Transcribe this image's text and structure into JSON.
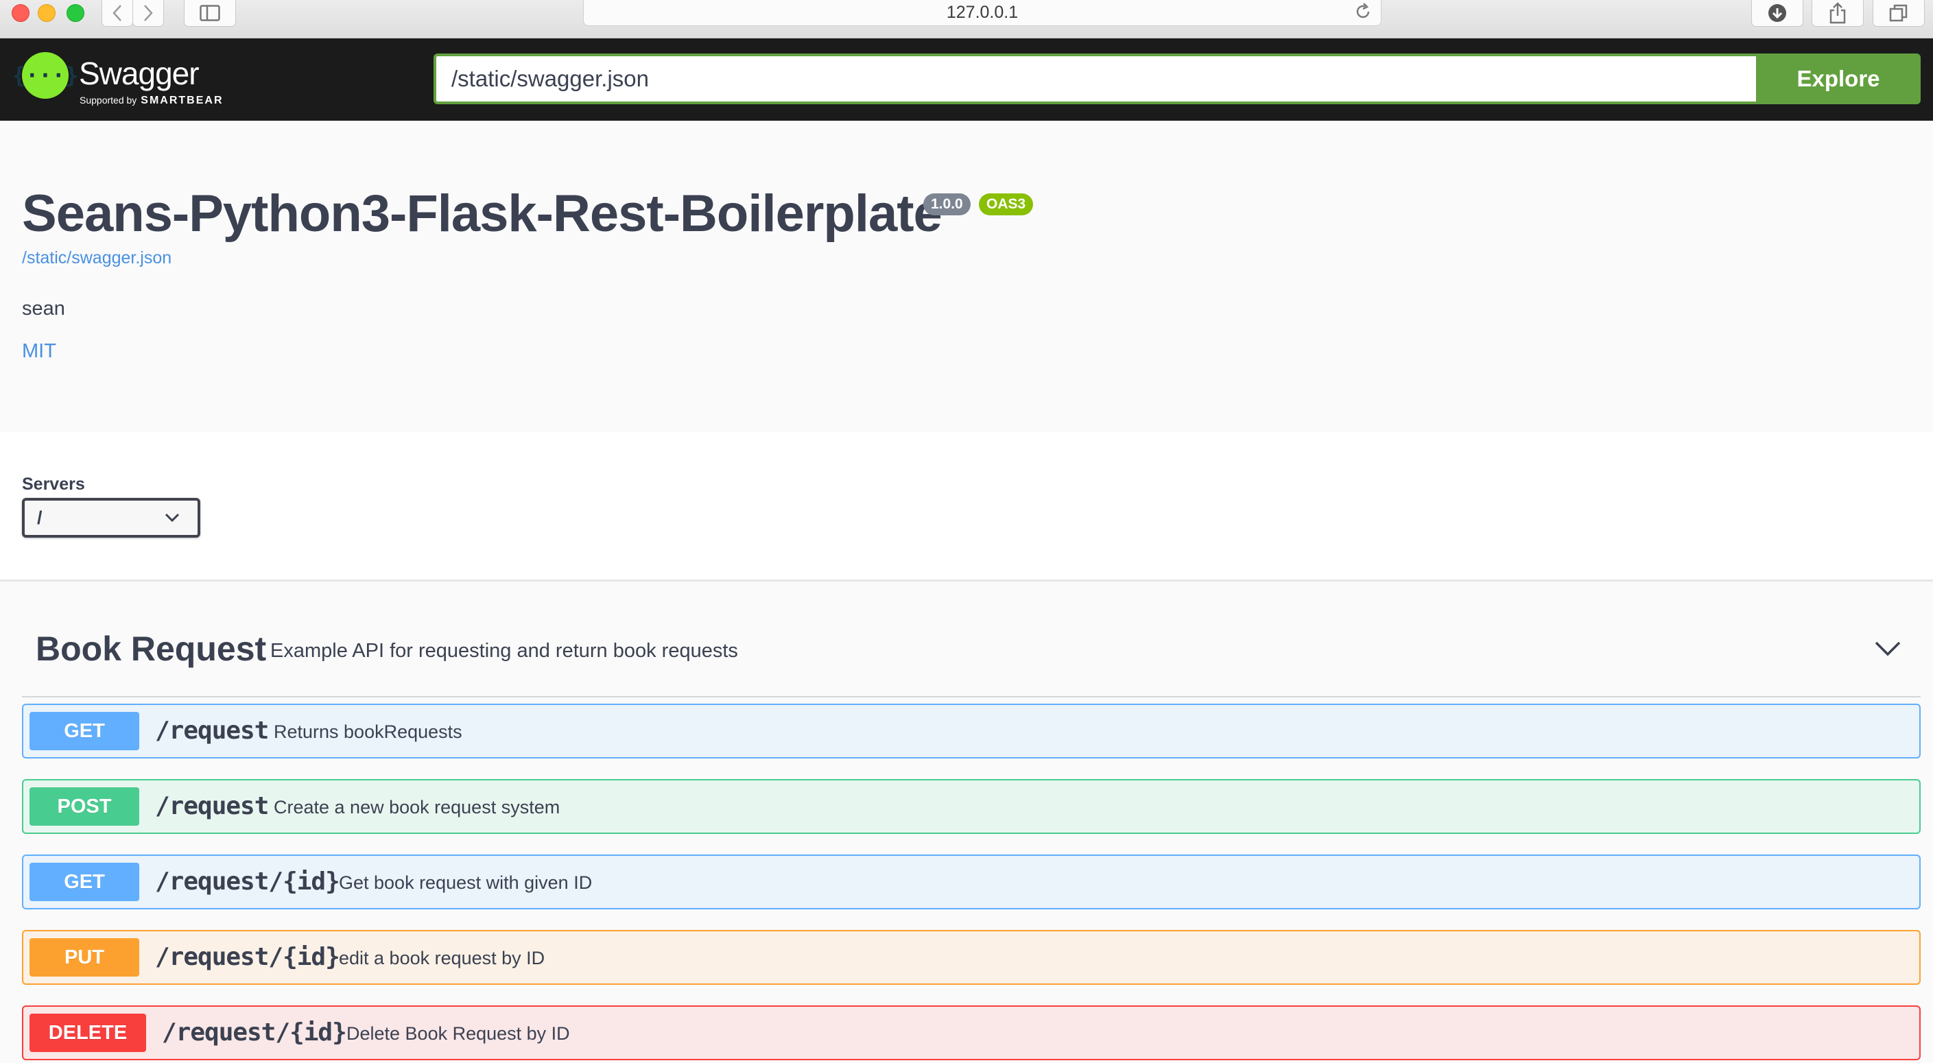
{
  "browser": {
    "address": "127.0.0.1"
  },
  "topbar": {
    "brand": "Swagger",
    "brand_sub_prefix": "Supported by",
    "brand_sub_company": "SMARTBEAR",
    "logo_glyph": "{···}",
    "url_value": "/static/swagger.json",
    "explore_label": "Explore",
    "accent_color": "#62a03f"
  },
  "info": {
    "title": "Seans-Python3-Flask-Rest-Boilerplate",
    "version": "1.0.0",
    "oas_badge": "OAS3",
    "spec_url": "/static/swagger.json",
    "contact": "sean",
    "license": "MIT"
  },
  "servers": {
    "label": "Servers",
    "selected": "/"
  },
  "tag": {
    "name": "Book Request",
    "description": "Example API for requesting and return book requests",
    "operations": [
      {
        "method": "GET",
        "path": "/request",
        "summary": "Returns bookRequests",
        "color": "#61affe"
      },
      {
        "method": "POST",
        "path": "/request",
        "summary": "Create a new book request system",
        "color": "#49cc90"
      },
      {
        "method": "GET",
        "path": "/request/{id}",
        "summary": "Get book request with given ID",
        "color": "#61affe"
      },
      {
        "method": "PUT",
        "path": "/request/{id}",
        "summary": "edit a book request by ID",
        "color": "#fca130"
      },
      {
        "method": "DELETE",
        "path": "/request/{id}",
        "summary": "Delete Book Request by ID",
        "color": "#f93e3e"
      }
    ]
  }
}
